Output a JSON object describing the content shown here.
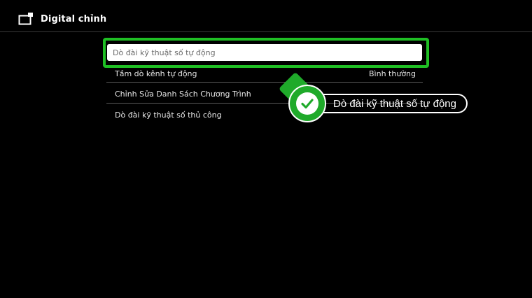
{
  "header": {
    "icon": "tv-input-icon",
    "title": "Digital chỉnh"
  },
  "menu": {
    "selected": {
      "label": "Dò đài kỹ thuật số tự động"
    },
    "items": [
      {
        "label": "Tầm dò kênh tự động",
        "value": "Bình thường"
      },
      {
        "label": "Chỉnh Sửa Danh Sách Chương Trình",
        "value": ""
      },
      {
        "label": "Dò đài kỹ thuật số thủ công",
        "value": ""
      }
    ]
  },
  "callout": {
    "icon": "checkmark-icon",
    "text": "Dò đài kỹ thuật số tự động",
    "color": "#1faa2a"
  },
  "colors": {
    "background": "#000000",
    "highlight": "#1fbf24",
    "text": "#e8e8e8"
  }
}
